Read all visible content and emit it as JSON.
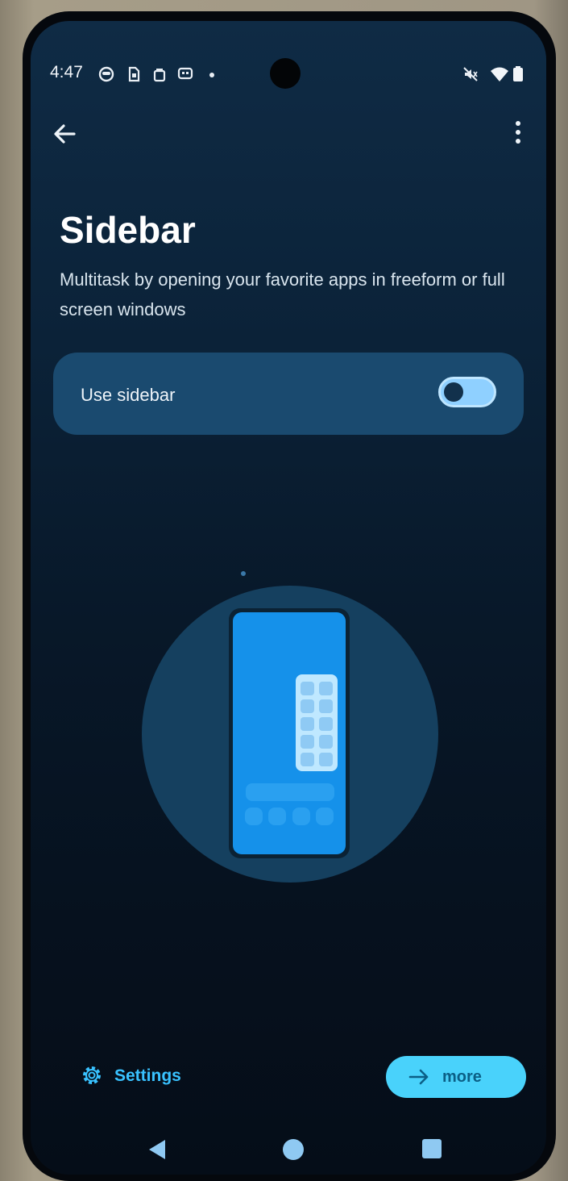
{
  "status_bar": {
    "time": "4:47",
    "left_icons": [
      "face-icon",
      "sim-icon",
      "bag-icon",
      "chat-icon",
      "notification-dot-icon"
    ],
    "right_icons": [
      "mute-icon",
      "wifi-icon",
      "battery-icon"
    ]
  },
  "app_bar": {
    "back_icon": "arrow-left-icon",
    "overflow_icon": "more-vert-icon"
  },
  "page": {
    "title": "Sidebar",
    "subtitle": "Multitask by opening your favorite apps in freeform or full screen windows"
  },
  "toggle": {
    "label": "Use sidebar",
    "state": "off"
  },
  "footer": {
    "settings_label": "Settings",
    "more_label": "more"
  },
  "colors": {
    "accent": "#49d2fb",
    "card": "#1a4a6f",
    "background": "#0b2238",
    "link": "#39c2ff"
  },
  "nav_bar": {
    "icons": [
      "nav-back-icon",
      "nav-home-icon",
      "nav-recents-icon"
    ]
  }
}
